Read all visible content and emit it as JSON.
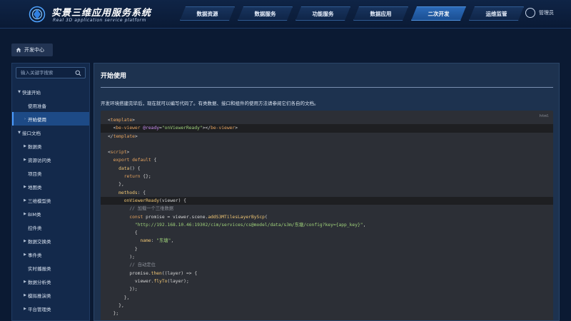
{
  "header": {
    "title": "实景三维应用服务系统",
    "subtitle": "Real 3D application service platform",
    "nav": [
      {
        "label": "数据资源",
        "active": false
      },
      {
        "label": "数据服务",
        "active": false
      },
      {
        "label": "功能服务",
        "active": false
      },
      {
        "label": "数据应用",
        "active": false
      },
      {
        "label": "二次开发",
        "active": true
      },
      {
        "label": "运维监管",
        "active": false
      }
    ],
    "user": {
      "icon": "user-avatar-icon",
      "name": "管理员"
    }
  },
  "breadcrumb": {
    "icon": "home-icon",
    "label": "开发中心"
  },
  "sidebar": {
    "search_placeholder": "输入关键字搜索",
    "tree": [
      {
        "label": "快速开始",
        "level": 0,
        "expanded": true
      },
      {
        "label": "使用准备",
        "level": 1,
        "hasArrow": false
      },
      {
        "label": "开始使用",
        "level": 1,
        "hasArrow": true,
        "active": true
      },
      {
        "label": "接口文档",
        "level": 0,
        "expanded": true
      },
      {
        "label": "数据类",
        "level": 1,
        "hasArrow": true
      },
      {
        "label": "资源访问类",
        "level": 1,
        "hasArrow": true
      },
      {
        "label": "项目类",
        "level": 1,
        "hasArrow": false
      },
      {
        "label": "地图类",
        "level": 1,
        "hasArrow": true
      },
      {
        "label": "三维模型类",
        "level": 1,
        "hasArrow": true
      },
      {
        "label": "BIM类",
        "level": 1,
        "hasArrow": true
      },
      {
        "label": "控件类",
        "level": 1,
        "hasArrow": false
      },
      {
        "label": "数据交换类",
        "level": 1,
        "hasArrow": true
      },
      {
        "label": "事件类",
        "level": 1,
        "hasArrow": true
      },
      {
        "label": "实时播报类",
        "level": 1,
        "hasArrow": false
      },
      {
        "label": "数据分析类",
        "level": 1,
        "hasArrow": true
      },
      {
        "label": "模拟推演类",
        "level": 1,
        "hasArrow": true
      },
      {
        "label": "平台管理类",
        "level": 1,
        "hasArrow": true
      }
    ]
  },
  "main": {
    "title": "开始使用",
    "intro": "开发环境搭建完毕后，现在就可以编写代码了。有类数据、接口和组件的使用方法请参阅它们各自的文档。",
    "code_lang": "html",
    "code_lines": [
      {
        "text": "<template>",
        "hl": false
      },
      {
        "text": "  <be-viewer @ready=\"onViewerReady\"></be-viewer>",
        "hl": true
      },
      {
        "text": "</template>",
        "hl": false
      },
      {
        "text": "",
        "hl": false
      },
      {
        "text": "<script>",
        "hl": false
      },
      {
        "text": "  export default {",
        "hl": false
      },
      {
        "text": "    data() {",
        "hl": false
      },
      {
        "text": "      return {};",
        "hl": false
      },
      {
        "text": "    },",
        "hl": false
      },
      {
        "text": "    methods: {",
        "hl": false
      },
      {
        "text": "      onViewerReady(viewer) {",
        "hl": true
      },
      {
        "text": "        // 加载一个三维数据",
        "hl": false
      },
      {
        "text": "        const promise = viewer.scene.addS3MTilesLayerByScp(",
        "hl": false
      },
      {
        "text": "          \"http://192.168.10.46:19302/cim/services/cs@model/data/s3m/东塘/config?key={app_key}\",",
        "hl": false
      },
      {
        "text": "          {",
        "hl": false
      },
      {
        "text": "            name: \"东塘\",",
        "hl": false
      },
      {
        "text": "          }",
        "hl": false
      },
      {
        "text": "        );",
        "hl": false
      },
      {
        "text": "        // 自动定位",
        "hl": false
      },
      {
        "text": "        promise.then((layer) => {",
        "hl": false
      },
      {
        "text": "          viewer.flyTo(layer);",
        "hl": false
      },
      {
        "text": "        });",
        "hl": false
      },
      {
        "text": "      },",
        "hl": false
      },
      {
        "text": "    },",
        "hl": false
      },
      {
        "text": "  };",
        "hl": false
      }
    ]
  }
}
